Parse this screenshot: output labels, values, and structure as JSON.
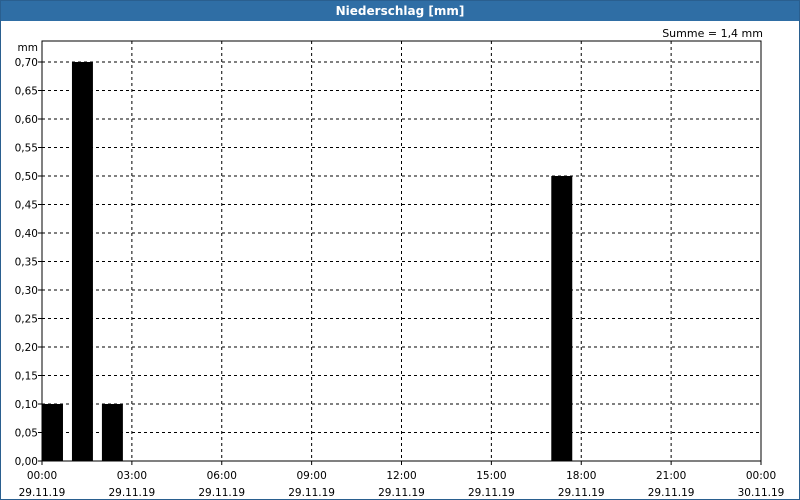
{
  "window": {
    "title": "Niederschlag [mm]"
  },
  "summary": {
    "text": "Summe = 1,4 mm"
  },
  "chart_data": {
    "type": "bar",
    "title": "Niederschlag [mm]",
    "ylabel": "mm",
    "xlabel": "",
    "ylim": [
      0,
      0.72
    ],
    "yticks": [
      "0,00",
      "0,05",
      "0,10",
      "0,15",
      "0,20",
      "0,25",
      "0,30",
      "0,35",
      "0,40",
      "0,45",
      "0,50",
      "0,55",
      "0,60",
      "0,65",
      "0,70"
    ],
    "xticks": [
      {
        "time": "00:00",
        "date": "29.11.19"
      },
      {
        "time": "03:00",
        "date": "29.11.19"
      },
      {
        "time": "06:00",
        "date": "29.11.19"
      },
      {
        "time": "09:00",
        "date": "29.11.19"
      },
      {
        "time": "12:00",
        "date": "29.11.19"
      },
      {
        "time": "15:00",
        "date": "29.11.19"
      },
      {
        "time": "18:00",
        "date": "29.11.19"
      },
      {
        "time": "21:00",
        "date": "29.11.19"
      },
      {
        "time": "00:00",
        "date": "30.11.19"
      }
    ],
    "x_unit": "hours",
    "xlim": [
      0,
      24
    ],
    "bar_width_hours": 0.7,
    "bars": [
      {
        "hour": 0.35,
        "value": 0.1
      },
      {
        "hour": 1.35,
        "value": 0.7
      },
      {
        "hour": 2.35,
        "value": 0.1
      },
      {
        "hour": 17.35,
        "value": 0.5
      }
    ],
    "grid": true,
    "colors": {
      "bar": "#000000",
      "grid": "#000000",
      "title_bar": "#2f6ea5"
    }
  }
}
